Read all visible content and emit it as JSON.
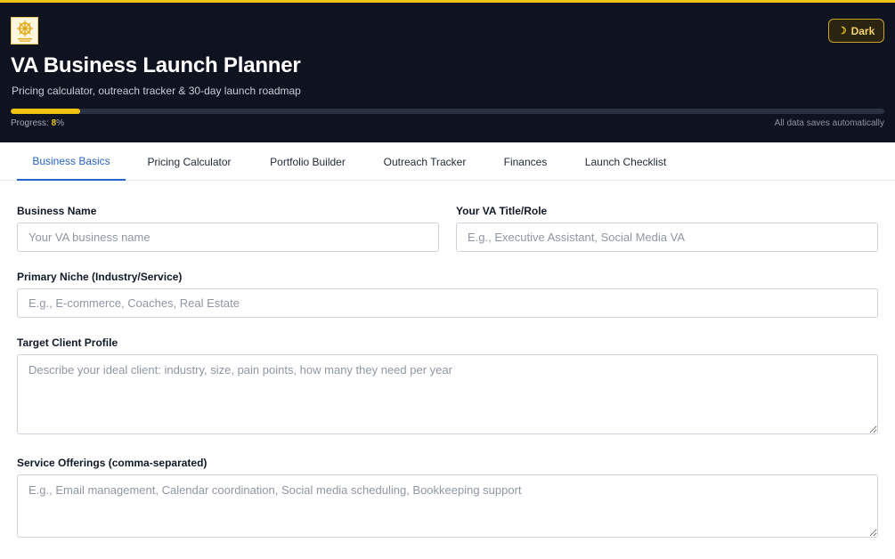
{
  "header": {
    "title": "VA Business Launch Planner",
    "subtitle": "Pricing calculator, outreach tracker & 30-day launch roadmap",
    "theme_button": "Dark",
    "progress_label": "Progress:",
    "progress_value": "8",
    "progress_unit": "%",
    "progress_fraction": 0.08,
    "autosave_text": "All data saves automatically",
    "accent_color": "#f3c313"
  },
  "tabs": [
    {
      "label": "Business Basics",
      "active": true
    },
    {
      "label": "Pricing Calculator",
      "active": false
    },
    {
      "label": "Portfolio Builder",
      "active": false
    },
    {
      "label": "Outreach Tracker",
      "active": false
    },
    {
      "label": "Finances",
      "active": false
    },
    {
      "label": "Launch Checklist",
      "active": false
    }
  ],
  "form": {
    "business_name": {
      "label": "Business Name",
      "value": "",
      "placeholder": "Your VA business name"
    },
    "va_title": {
      "label": "Your VA Title/Role",
      "value": "",
      "placeholder": "E.g., Executive Assistant, Social Media VA"
    },
    "niche": {
      "label": "Primary Niche (Industry/Service)",
      "value": "",
      "placeholder": "E.g., E-commerce, Coaches, Real Estate"
    },
    "target_client": {
      "label": "Target Client Profile",
      "value": "",
      "placeholder": "Describe your ideal client: industry, size, pain points, how many they need per year"
    },
    "services": {
      "label": "Service Offerings (comma-separated)",
      "value": "",
      "placeholder": "E.g., Email management, Calendar coordination, Social media scheduling, Bookkeeping support"
    }
  }
}
